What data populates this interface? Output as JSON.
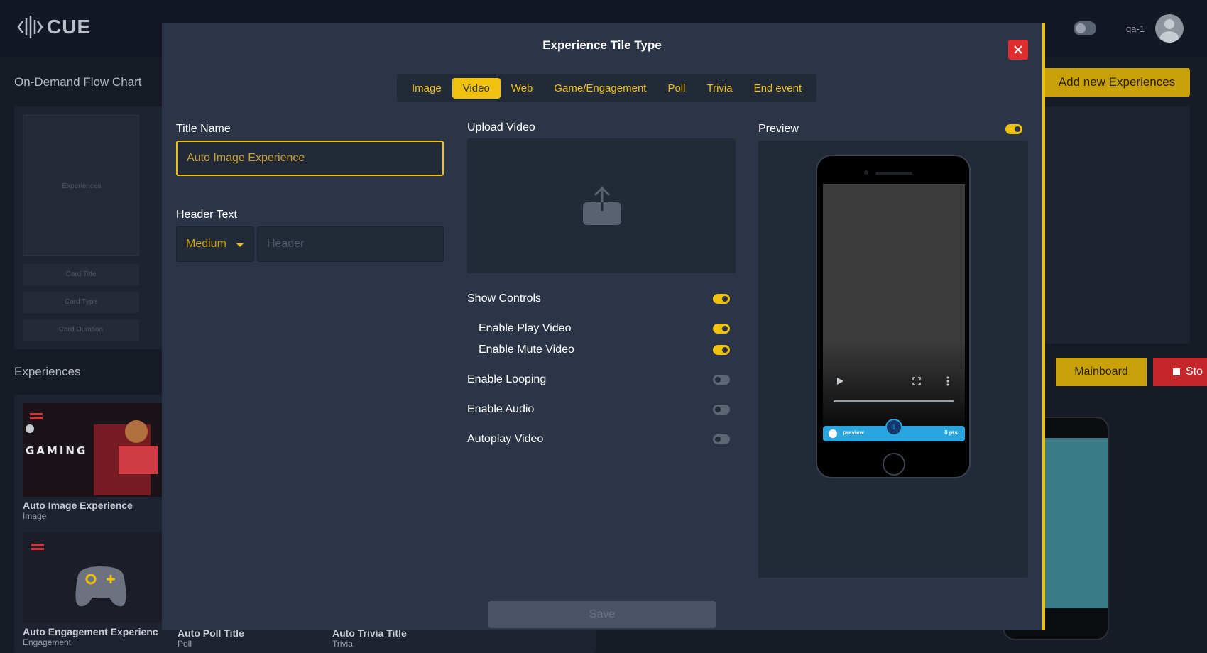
{
  "app": {
    "logo_text": "CUE"
  },
  "topbar": {
    "user_name": "qa-1"
  },
  "background": {
    "flow_chart_title": "On-Demand Flow Chart",
    "flow_card_label": "Experiences",
    "flow_fields": [
      "Card Title",
      "Card Type",
      "Card Duration"
    ],
    "experiences_title": "Experiences",
    "add_button_label": "Add new Experiences",
    "mainboard_label": "Mainboard",
    "stop_label": "Sto",
    "tiles": [
      {
        "title": "Auto Image Experience",
        "type": "Image",
        "thumb_text": "GAMING"
      },
      {
        "title": "Auto Engagement Experienc",
        "type": "Engagement"
      },
      {
        "title": "Auto Poll Title",
        "type": "Poll"
      },
      {
        "title": "Auto Trivia Title",
        "type": "Trivia"
      }
    ]
  },
  "modal": {
    "title": "Experience Tile Type",
    "tabs": [
      {
        "label": "Image",
        "active": false
      },
      {
        "label": "Video",
        "active": true
      },
      {
        "label": "Web",
        "active": false
      },
      {
        "label": "Game/Engagement",
        "active": false
      },
      {
        "label": "Poll",
        "active": false
      },
      {
        "label": "Trivia",
        "active": false
      },
      {
        "label": "End event",
        "active": false
      }
    ],
    "title_name_label": "Title Name",
    "title_name_value": "Auto Image Experience",
    "header_text_label": "Header Text",
    "header_size_value": "Medium",
    "header_placeholder": "Header",
    "upload_label": "Upload Video",
    "toggles": [
      {
        "label": "Show Controls",
        "on": true
      },
      {
        "label": "Enable Play Video",
        "on": true
      },
      {
        "label": "Enable Mute Video",
        "on": true
      },
      {
        "label": "Enable Looping",
        "on": false
      },
      {
        "label": "Enable Audio",
        "on": false
      },
      {
        "label": "Autoplay Video",
        "on": false
      }
    ],
    "preview_label": "Preview",
    "preview_toggle_on": true,
    "phone_bar": {
      "label": "preview",
      "points": "0 pts."
    },
    "save_label": "Save"
  },
  "colors": {
    "accent": "#f0c20d",
    "modal_bg": "#2c3547",
    "close": "#e02d2d",
    "phone_bar": "#29a6df"
  }
}
